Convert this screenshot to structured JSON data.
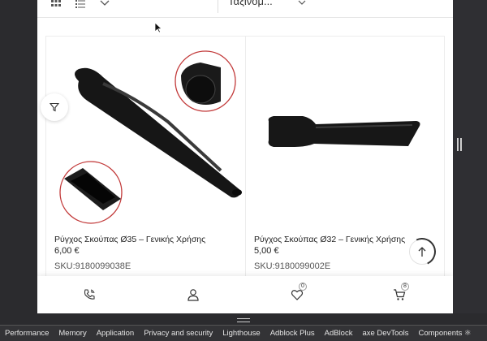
{
  "toolbar": {
    "grid_view_icon": "grid-icon",
    "list_view_icon": "list-icon",
    "sort_label": "Ταξινόμ..."
  },
  "products": [
    {
      "title": "Ρύγχος Σκούπας Ø35 – Γενικής Χρήσης",
      "price": "6,00 €",
      "sku": "SKU:9180099038E"
    },
    {
      "title": "Ρύγχος Σκούπας Ø32 – Γενικής Χρήσης",
      "price": "5,00 €",
      "sku": "SKU:9180099002E"
    }
  ],
  "bottom_nav": {
    "wishlist_count": "0",
    "cart_count": "8"
  },
  "devtools_tabs": [
    "Performance",
    "Memory",
    "Application",
    "Privacy and security",
    "Lighthouse",
    "Adblock Plus",
    "AdBlock",
    "axe DevTools",
    "Components ⚛"
  ],
  "colors": {
    "chrome_bg": "#2b2b2e",
    "product_black": "#141414",
    "magnifier_ring": "#c23a3a"
  }
}
